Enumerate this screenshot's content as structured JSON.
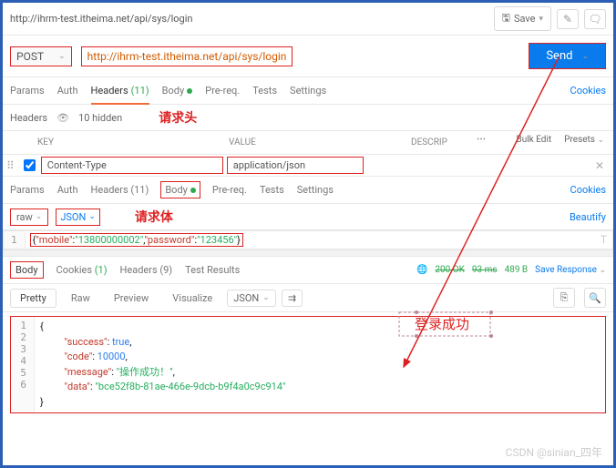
{
  "breadcrumb": "http://ihrm-test.itheima.net/api/sys/login",
  "top": {
    "save": "Save",
    "edit": "✎",
    "comment": "🗨"
  },
  "request": {
    "method": "POST",
    "url": "http://ihrm-test.itheima.net/api/sys/login",
    "send": "Send"
  },
  "tabs1": {
    "params": "Params",
    "auth": "Auth",
    "headers": "Headers",
    "headers_count": "(11)",
    "body": "Body",
    "prereq": "Pre-req.",
    "tests": "Tests",
    "settings": "Settings",
    "cookies": "Cookies"
  },
  "headers_sub": {
    "title": "Headers",
    "hidden": "10 hidden",
    "anno": "请求头"
  },
  "th": {
    "key": "KEY",
    "value": "VALUE",
    "desc": "DESCRIP",
    "bulk": "Bulk Edit",
    "presets": "Presets"
  },
  "hrow": {
    "key": "Content-Type",
    "value": "application/json"
  },
  "tabs2": {
    "params": "Params",
    "auth": "Auth",
    "headers": "Headers (11)",
    "body": "Body",
    "prereq": "Pre-req.",
    "tests": "Tests",
    "settings": "Settings",
    "cookies": "Cookies"
  },
  "bodyopt": {
    "raw": "raw",
    "json": "JSON",
    "anno": "请求体",
    "beautify": "Beautify"
  },
  "request_body": {
    "raw": "{\"mobile\":\"13800000002\",\"password\":\"123456\"}",
    "mobile_key": "\"mobile\"",
    "mobile_val": "\"13800000002\"",
    "password_key": "\"password\"",
    "password_val": "\"123456\""
  },
  "resp_tabs": {
    "body": "Body",
    "cookies": "Cookies",
    "cookies_count": "(1)",
    "headers": "Headers (9)",
    "tests": "Test Results"
  },
  "resp_meta": {
    "status": "200 OK",
    "time": "93 ms",
    "size": "489 B",
    "save": "Save Response"
  },
  "view": {
    "pretty": "Pretty",
    "raw": "Raw",
    "preview": "Preview",
    "visualize": "Visualize",
    "json": "JSON"
  },
  "chart_data": {
    "type": "table",
    "title": "Response JSON",
    "data": {
      "success": true,
      "code": 10000,
      "message": "操作成功！",
      "data": "bce52f8b-81ae-466e-9dcb-b9f4a0c9c914"
    }
  },
  "resp": {
    "l1": "{",
    "l2k": "\"success\"",
    "l2v": "true",
    "l2c": ": ",
    "l2e": ",",
    "l3k": "\"code\"",
    "l3v": "10000",
    "l3c": ": ",
    "l3e": ",",
    "l4k": "\"message\"",
    "l4v": "\"操作成功！\"",
    "l4c": ": ",
    "l4e": ",",
    "l5k": "\"data\"",
    "l5v": "\"bce52f8b-81ae-466e-9dcb-b9f4a0c9c914\"",
    "l5c": ": ",
    "l6": "}"
  },
  "anno2": "登录成功",
  "watermark": "CSDN @sinian_四年"
}
